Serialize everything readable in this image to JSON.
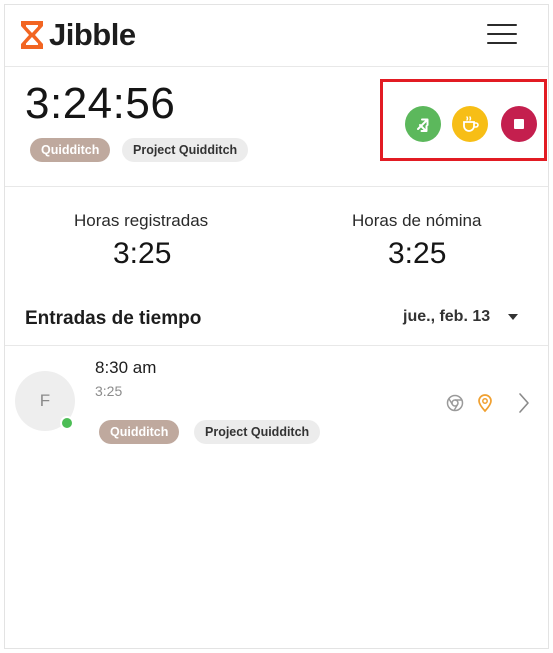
{
  "app": {
    "name": "Jibble"
  },
  "timer": {
    "elapsed": "3:24:56",
    "activity": "Quidditch",
    "project": "Project Quidditch",
    "actions": {
      "switch_icon": "switch-activity-icon",
      "break_icon": "coffee-cup-icon",
      "stop_icon": "stop-square-icon"
    }
  },
  "totals": {
    "tracked_label": "Horas registradas",
    "tracked_value": "3:25",
    "payroll_label": "Horas de nómina",
    "payroll_value": "3:25"
  },
  "entries": {
    "title": "Entradas de tiempo",
    "date": "jue., feb. 13",
    "items": [
      {
        "avatar_initial": "F",
        "time": "8:30 am",
        "duration": "3:25",
        "activity": "Quidditch",
        "project": "Project Quidditch",
        "source_icon": "chrome-icon",
        "location_icon": "location-pin-icon"
      }
    ]
  },
  "colors": {
    "brand_orange": "#f26522",
    "switch_green": "#5cb85c",
    "break_yellow": "#f7be16",
    "stop_red": "#c41f4e",
    "highlight_red": "#e21b23",
    "activity_pill": "#bfa99e",
    "online_green": "#4cbd55",
    "location_orange": "#f0a030"
  }
}
